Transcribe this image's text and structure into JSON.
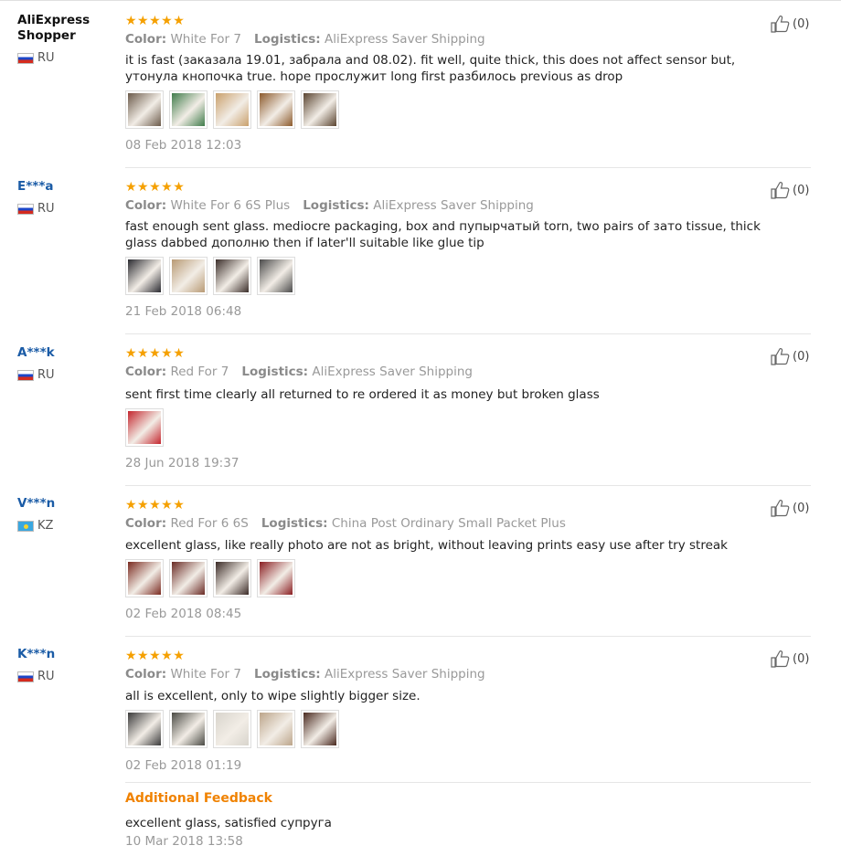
{
  "reviews": [
    {
      "user": "AliExpress Shopper",
      "user_is_link": false,
      "country": "RU",
      "flag": "ru",
      "stars": "★★★★★",
      "color_label": "Color:",
      "color_value": "White For 7",
      "logistics_label": "Logistics:",
      "logistics_value": "AliExpress Saver Shipping",
      "text": "it is fast (заказала 19.01, забрала and 08.02). fit well, quite thick, this does not affect sensor but, утонула кнопочка true. hope прослужит long first разбилось previous as drop",
      "thumbs": [
        "#6b5a4a",
        "#3f7b4a",
        "#c9a06c",
        "#8c5a2c",
        "#5a4430"
      ],
      "date": "08 Feb 2018 12:03",
      "likes": "(0)"
    },
    {
      "user": "E***a",
      "user_is_link": true,
      "country": "RU",
      "flag": "ru",
      "stars": "★★★★★",
      "color_label": "Color:",
      "color_value": "White For 6 6S Plus",
      "logistics_label": "Logistics:",
      "logistics_value": "AliExpress Saver Shipping",
      "text": "fast enough sent glass. mediocre packaging, box and пупырчатый torn, two pairs of зато tissue, thick glass dabbed дополню then if later'll suitable like glue tip",
      "thumbs": [
        "#2a2a30",
        "#b89a74",
        "#3b2e2a",
        "#4a4a4a"
      ],
      "date": "21 Feb 2018 06:48",
      "likes": "(0)"
    },
    {
      "user": "A***k",
      "user_is_link": true,
      "country": "RU",
      "flag": "ru",
      "stars": "★★★★★",
      "color_label": "Color:",
      "color_value": "Red For 7",
      "logistics_label": "Logistics:",
      "logistics_value": "AliExpress Saver Shipping",
      "text": "sent first time clearly all returned to re ordered it as money but broken glass",
      "thumbs": [
        "#c4262e"
      ],
      "date": "28 Jun 2018 19:37",
      "likes": "(0)"
    },
    {
      "user": "V***n",
      "user_is_link": true,
      "country": "KZ",
      "flag": "kz",
      "stars": "★★★★★",
      "color_label": "Color:",
      "color_value": "Red For 6 6S",
      "logistics_label": "Logistics:",
      "logistics_value": "China Post Ordinary Small Packet Plus",
      "text": "excellent glass, like really photo are not as bright, without leaving prints easy use after try streak",
      "thumbs": [
        "#7a2a20",
        "#6a2a24",
        "#3a2a26",
        "#8a1e22"
      ],
      "date": "02 Feb 2018 08:45",
      "likes": "(0)"
    },
    {
      "user": "K***n",
      "user_is_link": true,
      "country": "RU",
      "flag": "ru",
      "stars": "★★★★★",
      "color_label": "Color:",
      "color_value": "White For 7",
      "logistics_label": "Logistics:",
      "logistics_value": "AliExpress Saver Shipping",
      "text": "all is excellent, only to wipe slightly bigger size.",
      "thumbs": [
        "#3a3a3a",
        "#4a4a44",
        "#d8d4cc",
        "#bca58a",
        "#4a2a20"
      ],
      "date": "02 Feb 2018 01:19",
      "likes": "(0)"
    }
  ],
  "additional_feedback": {
    "title": "Additional Feedback",
    "text": "excellent glass, satisfied супруга",
    "date": "10 Mar 2018 13:58"
  }
}
